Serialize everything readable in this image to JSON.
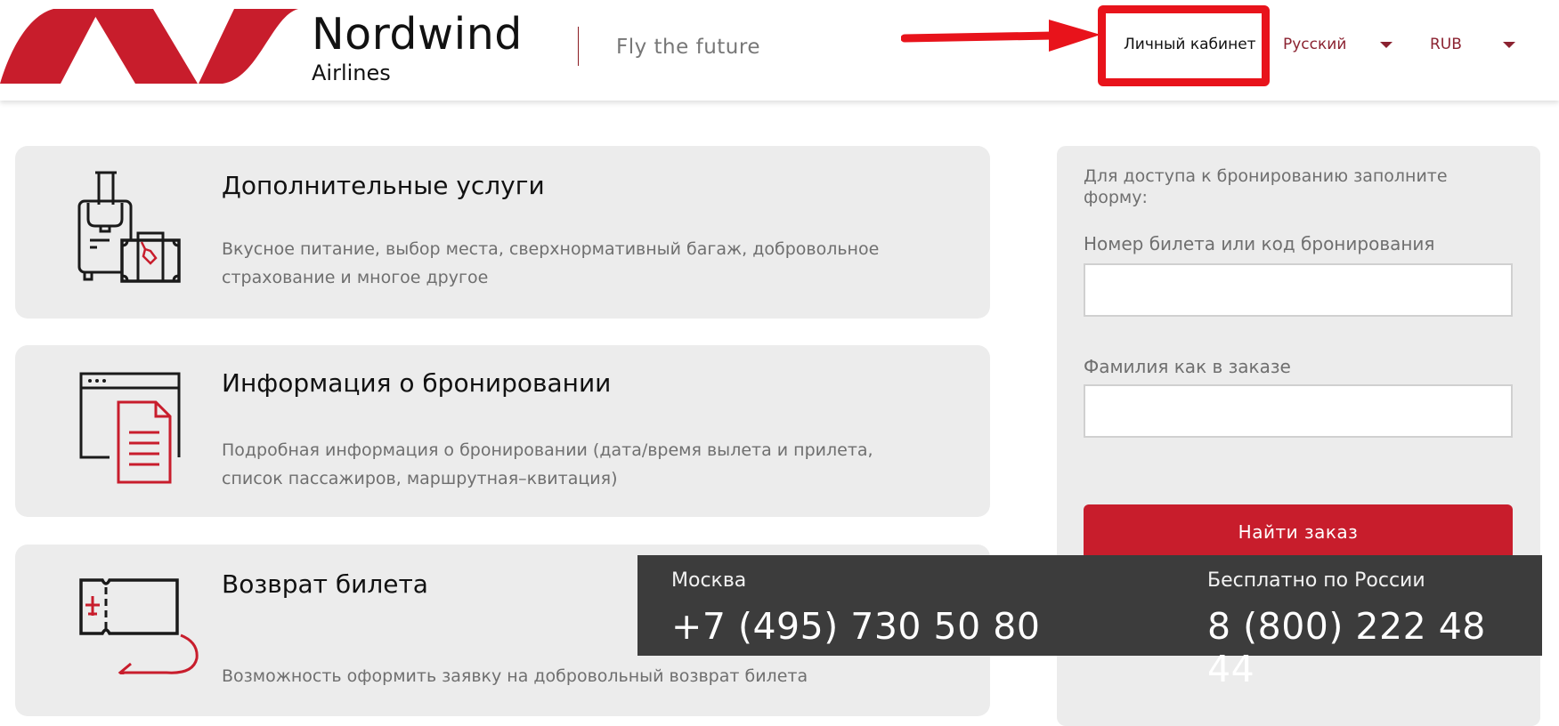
{
  "header": {
    "brand_name": "Nordwind",
    "brand_sub": "Airlines",
    "tagline": "Fly the future",
    "account_link": "Личный кабинет",
    "language": "Русский",
    "currency": "RUB"
  },
  "colors": {
    "brand_red": "#c81d2c",
    "annotation_red": "#e8131b",
    "select_text": "#8b2230",
    "card_bg": "#ececec",
    "contact_bg": "#3c3c3c"
  },
  "cards": [
    {
      "icon": "luggage-icon",
      "title": "Дополнительные услуги",
      "description": "Вкусное питание, выбор места, сверхнормативный багаж, добровольное страхование и многое другое"
    },
    {
      "icon": "booking-document-icon",
      "title": "Информация о бронировании",
      "description": "Подробная информация о бронировании (дата/время вылета и прилета, список пассажиров, маршрутная–квитация)"
    },
    {
      "icon": "ticket-return-icon",
      "title": "Возврат билета",
      "description": "Возможность оформить заявку на добровольный возврат билета"
    }
  ],
  "form": {
    "intro": "Для доступа к бронированию заполните форму:",
    "ticket_label": "Номер билета или код бронирования",
    "ticket_value": "",
    "surname_label": "Фамилия как в заказе",
    "surname_value": "",
    "submit_label": "Найти заказ"
  },
  "contacts": [
    {
      "label": "Москва",
      "phone": "+7 (495) 730 50 80"
    },
    {
      "label": "Бесплатно по России",
      "phone": "8 (800) 222 48 44"
    }
  ]
}
